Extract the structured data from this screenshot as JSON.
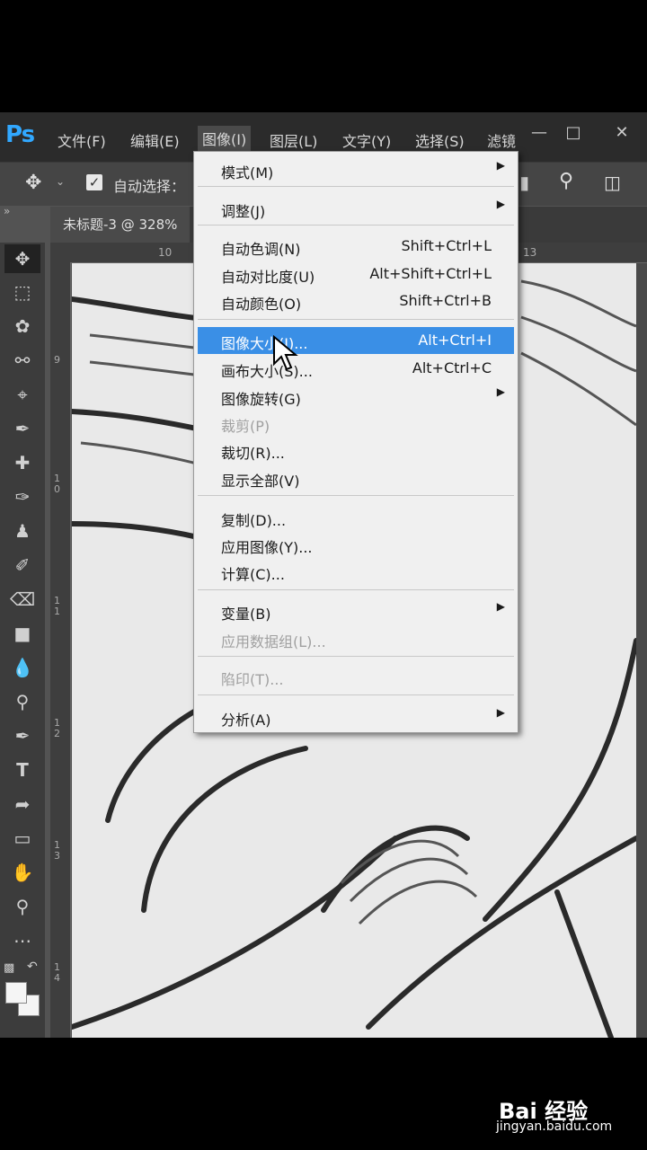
{
  "menubar": {
    "logo": "Ps",
    "items": [
      "文件(F)",
      "编辑(E)",
      "图像(I)",
      "图层(L)",
      "文字(Y)",
      "选择(S)",
      "滤镜"
    ]
  },
  "window_controls": [
    "minimize-icon",
    "restore-icon",
    "close-icon"
  ],
  "options_bar": {
    "auto_select_label": "自动选择：",
    "auto_select_checked": true
  },
  "document_tab": "未标题-3 @ 328%",
  "rulers": {
    "top": [
      "10",
      "13"
    ],
    "left": [
      "9",
      "1\n0",
      "1\n1",
      "1\n2",
      "1\n3",
      "1\n4"
    ]
  },
  "image_menu": {
    "items": [
      {
        "label": "模式(M)",
        "shortcut": "",
        "submenu": true,
        "disabled": false,
        "highlighted": false
      },
      {
        "label": "调整(J)",
        "shortcut": "",
        "submenu": true,
        "disabled": false,
        "highlighted": false
      },
      {
        "label": "自动色调(N)",
        "shortcut": "Shift+Ctrl+L",
        "submenu": false,
        "disabled": false,
        "highlighted": false
      },
      {
        "label": "自动对比度(U)",
        "shortcut": "Alt+Shift+Ctrl+L",
        "submenu": false,
        "disabled": false,
        "highlighted": false
      },
      {
        "label": "自动颜色(O)",
        "shortcut": "Shift+Ctrl+B",
        "submenu": false,
        "disabled": false,
        "highlighted": false
      },
      {
        "label": "图像大小(I)...",
        "shortcut": "Alt+Ctrl+I",
        "submenu": false,
        "disabled": false,
        "highlighted": true
      },
      {
        "label": "画布大小(S)...",
        "shortcut": "Alt+Ctrl+C",
        "submenu": false,
        "disabled": false,
        "highlighted": false
      },
      {
        "label": "图像旋转(G)",
        "shortcut": "",
        "submenu": true,
        "disabled": false,
        "highlighted": false
      },
      {
        "label": "裁剪(P)",
        "shortcut": "",
        "submenu": false,
        "disabled": true,
        "highlighted": false
      },
      {
        "label": "裁切(R)...",
        "shortcut": "",
        "submenu": false,
        "disabled": false,
        "highlighted": false
      },
      {
        "label": "显示全部(V)",
        "shortcut": "",
        "submenu": false,
        "disabled": false,
        "highlighted": false
      },
      {
        "label": "复制(D)...",
        "shortcut": "",
        "submenu": false,
        "disabled": false,
        "highlighted": false
      },
      {
        "label": "应用图像(Y)...",
        "shortcut": "",
        "submenu": false,
        "disabled": false,
        "highlighted": false
      },
      {
        "label": "计算(C)...",
        "shortcut": "",
        "submenu": false,
        "disabled": false,
        "highlighted": false
      },
      {
        "label": "变量(B)",
        "shortcut": "",
        "submenu": true,
        "disabled": false,
        "highlighted": false
      },
      {
        "label": "应用数据组(L)...",
        "shortcut": "",
        "submenu": false,
        "disabled": true,
        "highlighted": false
      },
      {
        "label": "陷印(T)...",
        "shortcut": "",
        "submenu": false,
        "disabled": true,
        "highlighted": false
      },
      {
        "label": "分析(A)",
        "shortcut": "",
        "submenu": true,
        "disabled": false,
        "highlighted": false
      }
    ]
  },
  "watermark": {
    "brand": "Bai 经验",
    "url": "jingyan.baidu.com"
  },
  "colors": {
    "highlight": "#3a8fe6",
    "logo": "#31a8ff"
  }
}
